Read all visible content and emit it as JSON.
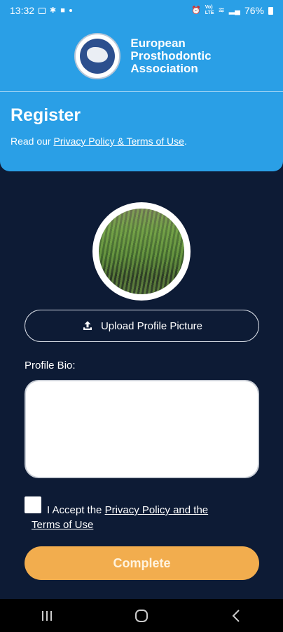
{
  "status_bar": {
    "time": "13:32",
    "battery_percent": "76%",
    "left_icons": [
      "image-icon",
      "notification-icon",
      "message-icon",
      "dot-icon"
    ],
    "right_icons": [
      "alarm-icon",
      "volte-icon",
      "wifi-icon",
      "signal-icon",
      "battery-icon"
    ]
  },
  "header": {
    "logo_line1": "European",
    "logo_line2": "Prosthodontic",
    "logo_line3": "Association",
    "page_title": "Register",
    "policy_prefix": "Read our ",
    "policy_link": "Privacy Policy & Terms of Use",
    "policy_suffix": ".",
    "background_color": "#2a9fe6"
  },
  "profile": {
    "upload_label": "Upload Profile Picture",
    "bio_label": "Profile Bio:",
    "bio_value": ""
  },
  "terms": {
    "accept_prefix": "I Accept the ",
    "accept_link_line1": "Privacy Policy and the",
    "accept_link_line2": "Terms of Use",
    "checked": false
  },
  "actions": {
    "complete_label": "Complete",
    "complete_color": "#f2ad4e"
  },
  "nav_bar": {
    "icons": [
      "recent-apps-icon",
      "home-icon",
      "back-icon"
    ]
  },
  "colors": {
    "page_background": "#0d1b35",
    "accent": "#2a9fe6"
  }
}
